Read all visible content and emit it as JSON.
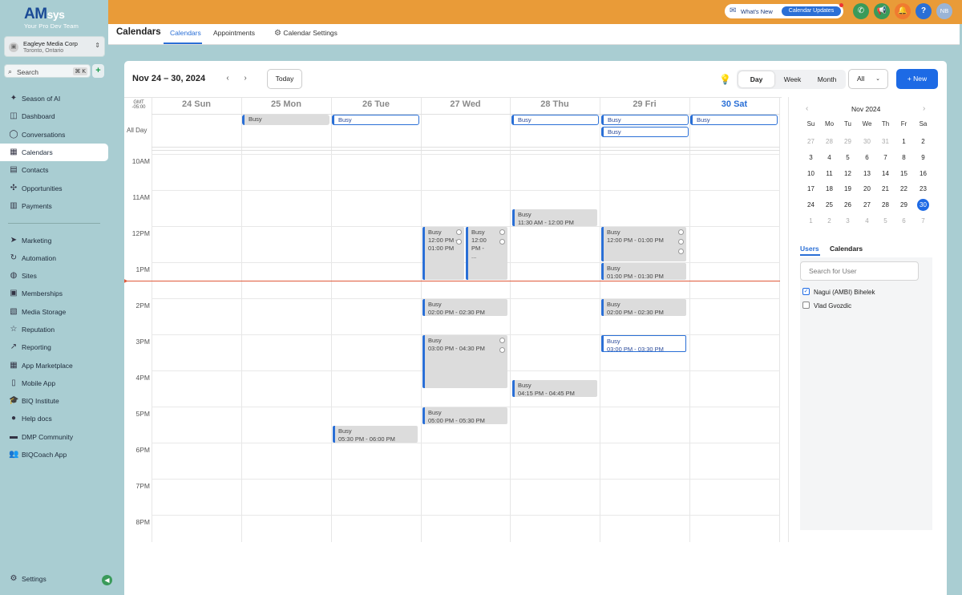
{
  "brand": {
    "logo": "AM",
    "logo_suffix": "sys",
    "tagline": "Your Pro Dev Team"
  },
  "account": {
    "name": "Eagleye Media Corp",
    "location": "Toronto, Ontario"
  },
  "search": {
    "label": "Search",
    "shortcut": "⌘ K"
  },
  "sidebar": {
    "items": [
      {
        "label": "Season of AI",
        "icon": "sparkle-icon"
      },
      {
        "label": "Dashboard",
        "icon": "dashboard-icon"
      },
      {
        "label": "Conversations",
        "icon": "chat-icon"
      },
      {
        "label": "Calendars",
        "icon": "calendar-icon"
      },
      {
        "label": "Contacts",
        "icon": "contacts-icon"
      },
      {
        "label": "Opportunities",
        "icon": "opportunities-icon"
      },
      {
        "label": "Payments",
        "icon": "payments-icon"
      },
      {
        "label": "Marketing",
        "icon": "send-icon"
      },
      {
        "label": "Automation",
        "icon": "automation-icon"
      },
      {
        "label": "Sites",
        "icon": "sites-icon"
      },
      {
        "label": "Memberships",
        "icon": "memberships-icon"
      },
      {
        "label": "Media Storage",
        "icon": "media-icon"
      },
      {
        "label": "Reputation",
        "icon": "star-icon"
      },
      {
        "label": "Reporting",
        "icon": "reporting-icon"
      },
      {
        "label": "App Marketplace",
        "icon": "marketplace-icon"
      },
      {
        "label": "Mobile App",
        "icon": "mobile-icon"
      },
      {
        "label": "BIQ Institute",
        "icon": "graduation-icon"
      },
      {
        "label": "Help docs",
        "icon": "help-icon"
      },
      {
        "label": "DMP Community",
        "icon": "community-icon"
      },
      {
        "label": "BIQCoach App",
        "icon": "coach-icon"
      }
    ],
    "settings": "Settings"
  },
  "topbar": {
    "whats_new": "What's New",
    "calendar_updates": "Calendar Updates",
    "avatar": "NB"
  },
  "subheader": {
    "title": "Calendars",
    "tabs": [
      "Calendars",
      "Appointments",
      "Calendar Settings"
    ]
  },
  "toolbar": {
    "range": "Nov 24 – 30, 2024",
    "today": "Today",
    "views": [
      "Day",
      "Week",
      "Month"
    ],
    "filter": "All",
    "new_label": "+ New"
  },
  "timezone": {
    "gmt": "GMT",
    "offset": "-05:00"
  },
  "all_day_label": "All Day",
  "days": [
    "24 Sun",
    "25 Mon",
    "26 Tue",
    "27 Wed",
    "28 Thu",
    "29 Fri",
    "30 Sat"
  ],
  "hours": [
    "10AM",
    "11AM",
    "12PM",
    "1PM",
    "2PM",
    "3PM",
    "4PM",
    "5PM",
    "6PM",
    "7PM",
    "8PM"
  ],
  "all_day_events": [
    {
      "day": 1,
      "label": "Busy",
      "style": "gray"
    },
    {
      "day": 2,
      "label": "Busy",
      "style": "outline"
    },
    {
      "day": 4,
      "label": "Busy",
      "style": "outline"
    },
    {
      "day": 5,
      "label": "Busy",
      "style": "outline"
    },
    {
      "day": 5,
      "label": "Busy",
      "style": "outline"
    },
    {
      "day": 6,
      "label": "Busy",
      "style": "outline"
    }
  ],
  "events": [
    {
      "title": "Busy",
      "time": "05:30 PM - 06:00 PM"
    },
    {
      "title": "Busy",
      "time": "12:00 PM - 01:00 PM"
    },
    {
      "title": "Busy",
      "time": "12:00 PM - ..."
    },
    {
      "title": "Busy",
      "time": "02:00 PM - 02:30 PM"
    },
    {
      "title": "Busy",
      "time": "03:00 PM - 04:30 PM"
    },
    {
      "title": "Busy",
      "time": "05:00 PM - 05:30 PM"
    },
    {
      "title": "Busy",
      "time": "11:30 AM - 12:00 PM"
    },
    {
      "title": "Busy",
      "time": "04:15 PM - 04:45 PM"
    },
    {
      "title": "Busy",
      "time": "12:00 PM - 01:00 PM"
    },
    {
      "title": "Busy",
      "time": "01:00 PM - 01:30 PM"
    },
    {
      "title": "Busy",
      "time": "02:00 PM - 02:30 PM"
    },
    {
      "title": "Busy",
      "time": "03:00 PM - 03:30 PM"
    }
  ],
  "mini_calendar": {
    "month": "Nov 2024",
    "weekdays": [
      "Su",
      "Mo",
      "Tu",
      "We",
      "Th",
      "Fr",
      "Sa"
    ],
    "weeks": [
      [
        "27",
        "28",
        "29",
        "30",
        "31",
        "1",
        "2"
      ],
      [
        "3",
        "4",
        "5",
        "6",
        "7",
        "8",
        "9"
      ],
      [
        "10",
        "11",
        "12",
        "13",
        "14",
        "15",
        "16"
      ],
      [
        "17",
        "18",
        "19",
        "20",
        "21",
        "22",
        "23"
      ],
      [
        "24",
        "25",
        "26",
        "27",
        "28",
        "29",
        "30"
      ],
      [
        "1",
        "2",
        "3",
        "4",
        "5",
        "6",
        "7"
      ]
    ],
    "selected": "30"
  },
  "right_tabs": [
    "Users",
    "Calendars"
  ],
  "user_search_placeholder": "Search for User",
  "users": [
    {
      "name": "Nagui (AMBI) Bihelek",
      "checked": true
    },
    {
      "name": "Vlad Gvozdic",
      "checked": false
    }
  ],
  "colors": {
    "accent": "#2a6fd6",
    "topbar": "#e99b38",
    "sidebar": "#a9cdd2",
    "now_line": "#e05a3a"
  }
}
